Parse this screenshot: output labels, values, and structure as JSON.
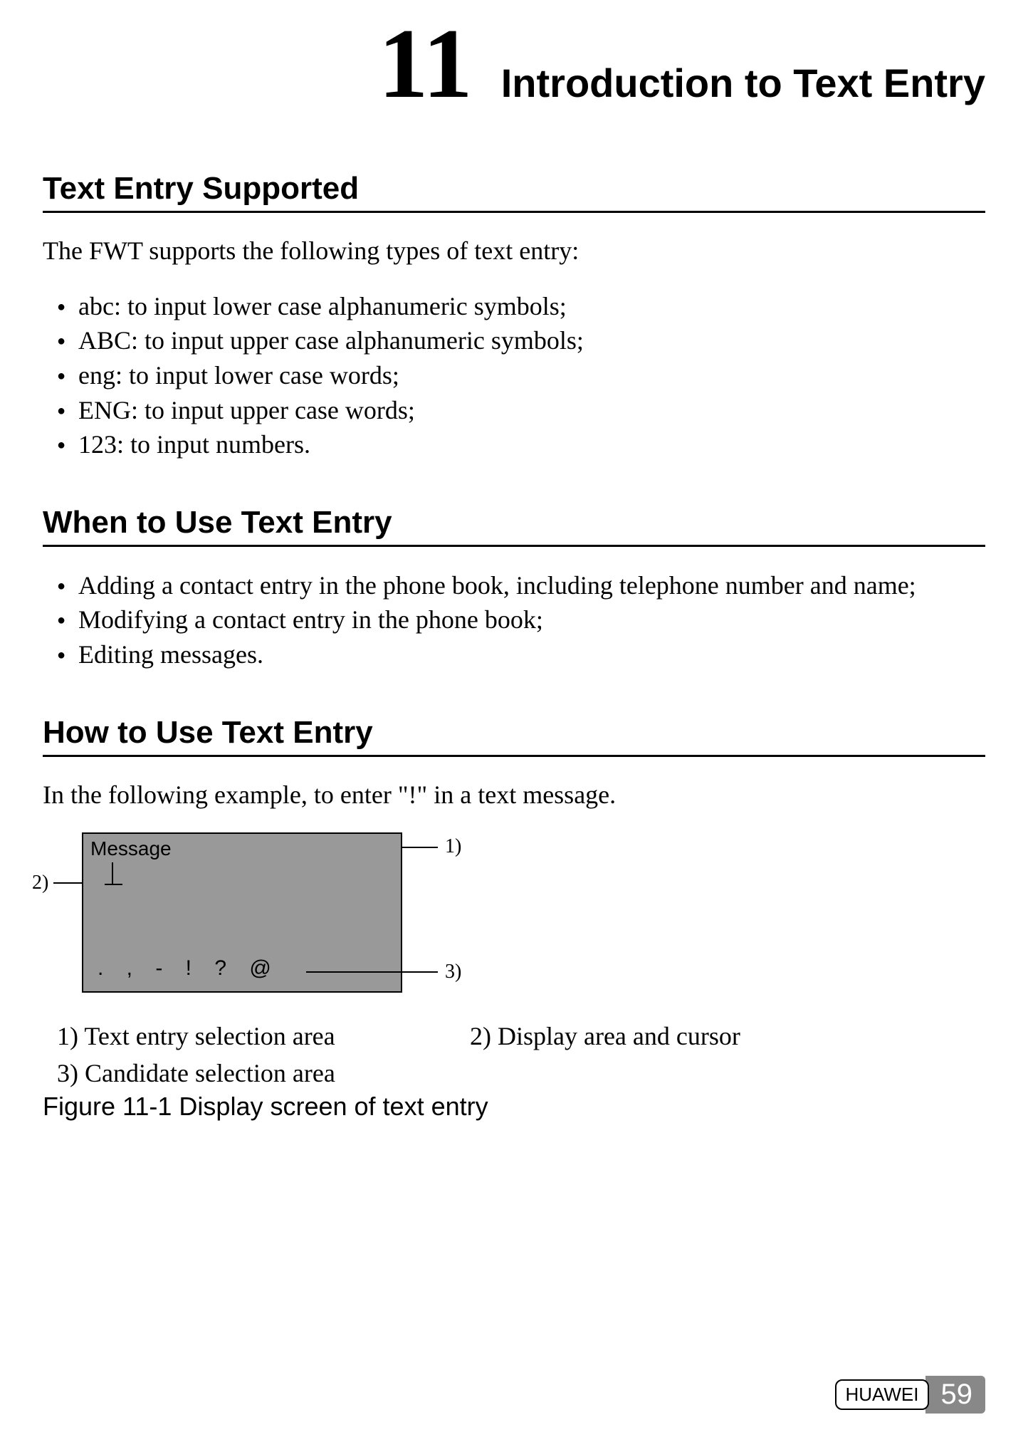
{
  "chapter": {
    "number": "11",
    "title": "Introduction to Text Entry"
  },
  "section1": {
    "heading": "Text Entry Supported",
    "intro": "The FWT supports the following types of text entry:",
    "items": [
      "abc: to input lower case alphanumeric symbols;",
      "ABC: to input upper case alphanumeric symbols;",
      "eng: to input lower case words;",
      "ENG: to input upper case words;",
      "123: to input numbers."
    ]
  },
  "section2": {
    "heading": "When to Use Text Entry",
    "items": [
      "Adding a contact entry in the phone book, including telephone number and name;",
      "Modifying a contact entry in the phone book;",
      "Editing messages."
    ]
  },
  "section3": {
    "heading": "How to Use Text Entry",
    "intro": "In the following example, to enter \"!\" in a text message.",
    "figure": {
      "screen_title": "Message",
      "candidates": ". , - ! ? @",
      "callouts": {
        "c1": "1)",
        "c2": "2)",
        "c3": "3)"
      },
      "legend": {
        "l1": "1) Text entry selection area",
        "l2": "2) Display area and cursor",
        "l3": "3) Candidate selection area"
      },
      "caption": "Figure 11-1 Display screen of text entry"
    }
  },
  "footer": {
    "brand": "HUAWEI",
    "page": "59"
  }
}
